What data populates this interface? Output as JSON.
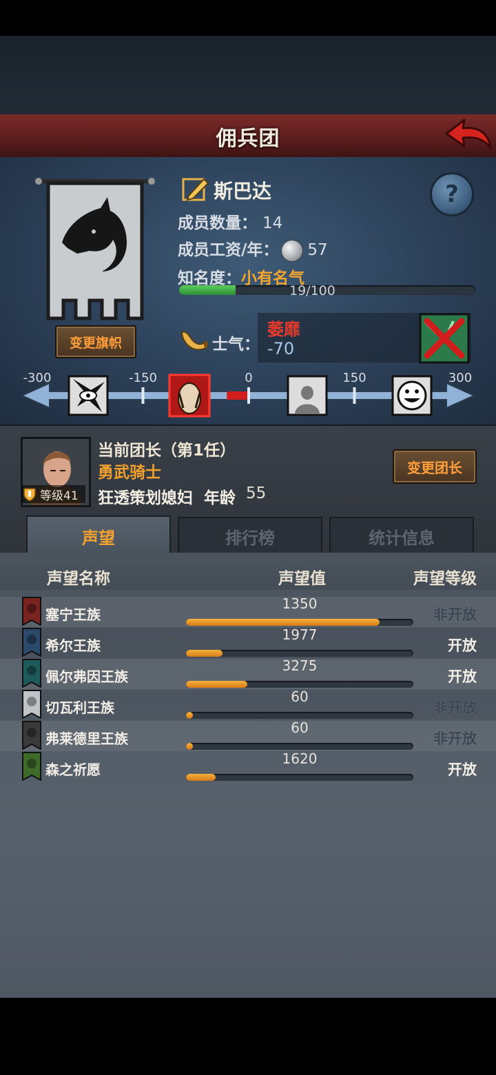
{
  "header": {
    "title": "佣兵团",
    "back_icon": "back-arrow-icon"
  },
  "guild": {
    "name": "斯巴达",
    "members_label": "成员数量：",
    "members_value": "14",
    "wage_label": "成员工资/年：",
    "wage_value": "57",
    "fame_label": "知名度：",
    "fame_value": "小有名气",
    "fame_progress_text": "19/100",
    "fame_progress": 0.19,
    "change_banner_label": "变更旗帜"
  },
  "morale": {
    "label": "士气：",
    "state": "萎靡",
    "value": "-70",
    "ticks": [
      "-300",
      "-150",
      "0",
      "150",
      "300"
    ],
    "current": -70,
    "min": -300,
    "max": 300
  },
  "leader": {
    "title": "当前团长（第1任）",
    "class": "勇武骑士",
    "trait": "狂透策划媳妇",
    "age_label": "年龄",
    "age": "55",
    "level_text": "等级41",
    "change_leader_label": "变更团长"
  },
  "tabs": [
    "声望",
    "排行榜",
    "统计信息"
  ],
  "reputation": {
    "headers": [
      "声望名称",
      "声望值",
      "声望等级"
    ],
    "rows": [
      {
        "name": "塞宁王族",
        "value": "1350",
        "fill": 0.85,
        "level": "非开放",
        "open": false,
        "color": "#7a2420"
      },
      {
        "name": "希尔王族",
        "value": "1977",
        "fill": 0.16,
        "level": "开放",
        "open": true,
        "color": "#2b4a6a"
      },
      {
        "name": "佩尔弗因王族",
        "value": "3275",
        "fill": 0.27,
        "level": "开放",
        "open": true,
        "color": "#1f5a5a"
      },
      {
        "name": "切瓦利王族",
        "value": "60",
        "fill": 0.03,
        "level": "非开放",
        "open": false,
        "color": "#bfc4c8"
      },
      {
        "name": "弗莱德里王族",
        "value": "60",
        "fill": 0.03,
        "level": "非开放",
        "open": false,
        "color": "#3a3a3a"
      },
      {
        "name": "森之祈愿",
        "value": "1620",
        "fill": 0.13,
        "level": "开放",
        "open": true,
        "color": "#3f6b2a"
      }
    ]
  }
}
